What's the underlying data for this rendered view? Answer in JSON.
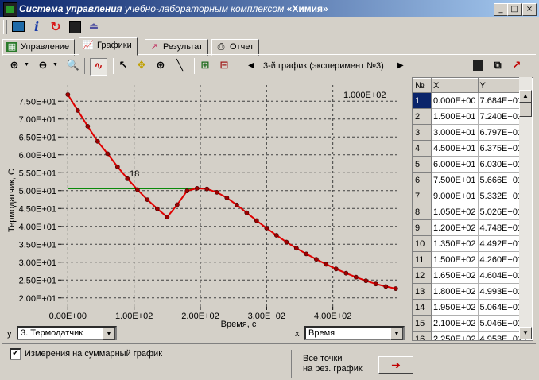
{
  "window": {
    "title_bold": "Система управления",
    "title_rest": " учебно-лабораторным комплексом ",
    "title_quoted": "«Химия»",
    "buttons": [
      "_",
      "□",
      "×"
    ]
  },
  "toolbar": {
    "icons": [
      "monitor-icon",
      "info-icon",
      "refresh-icon",
      "save-icon",
      "exit-icon"
    ],
    "info_glyph": "i"
  },
  "tabs": [
    {
      "label": "Управление"
    },
    {
      "label": "Графики"
    },
    {
      "label": "Результат"
    },
    {
      "label": "Отчет"
    }
  ],
  "graph_toolbar": {
    "nav_label": "3-й график (эксперимент №3)",
    "prev": "◀",
    "next": "▶"
  },
  "chart_data": {
    "type": "line",
    "xlabel": "Время, с",
    "ylabel": "Термодатчик, С",
    "corner_label": "1.000E+02",
    "point_marker": "18",
    "x_ticks": [
      "0.00E+00",
      "1.00E+02",
      "2.00E+02",
      "3.00E+02",
      "4.00E+02"
    ],
    "y_ticks": [
      "7.50E+01",
      "7.00E+01",
      "6.50E+01",
      "6.00E+01",
      "5.50E+01",
      "5.00E+01",
      "4.50E+01",
      "4.00E+01",
      "3.50E+01",
      "3.00E+01",
      "2.50E+01",
      "2.00E+01"
    ],
    "xlim": [
      -10,
      500
    ],
    "ylim": [
      17.5,
      79.5
    ],
    "hline": {
      "y": 50.6,
      "x_from": 0,
      "x_to": 210,
      "color": "#0a8a0a"
    },
    "series": [
      {
        "color": "#e00000",
        "x": [
          0,
          15,
          30,
          45,
          60,
          75,
          90,
          105,
          120,
          135,
          150,
          165,
          180,
          195,
          210,
          225,
          240,
          255,
          270,
          285,
          300,
          315,
          330,
          345,
          360,
          375,
          390,
          405,
          420,
          435,
          450,
          465,
          480,
          495
        ],
        "y": [
          76.84,
          72.4,
          67.97,
          63.75,
          60.3,
          56.66,
          53.32,
          50.26,
          47.48,
          44.92,
          42.6,
          46.04,
          49.93,
          50.64,
          50.46,
          49.53,
          48.0,
          46.0,
          43.8,
          41.6,
          39.5,
          37.5,
          35.6,
          33.9,
          32.3,
          30.8,
          29.4,
          28.1,
          26.9,
          25.8,
          24.8,
          23.9,
          23.2,
          22.6
        ]
      }
    ]
  },
  "table": {
    "headers": [
      "№",
      "X",
      "Y"
    ],
    "rows": [
      [
        "1",
        "0.000E+00",
        "7.684E+01"
      ],
      [
        "2",
        "1.500E+01",
        "7.240E+01"
      ],
      [
        "3",
        "3.000E+01",
        "6.797E+01"
      ],
      [
        "4",
        "4.500E+01",
        "6.375E+01"
      ],
      [
        "5",
        "6.000E+01",
        "6.030E+01"
      ],
      [
        "6",
        "7.500E+01",
        "5.666E+01"
      ],
      [
        "7",
        "9.000E+01",
        "5.332E+01"
      ],
      [
        "8",
        "1.050E+02",
        "5.026E+01"
      ],
      [
        "9",
        "1.200E+02",
        "4.748E+01"
      ],
      [
        "10",
        "1.350E+02",
        "4.492E+01"
      ],
      [
        "11",
        "1.500E+02",
        "4.260E+01"
      ],
      [
        "12",
        "1.650E+02",
        "4.604E+01"
      ],
      [
        "13",
        "1.800E+02",
        "4.993E+01"
      ],
      [
        "14",
        "1.950E+02",
        "5.064E+01"
      ],
      [
        "15",
        "2.100E+02",
        "5.046E+01"
      ],
      [
        "16",
        "2.250E+02",
        "4.953E+01"
      ]
    ]
  },
  "controls": {
    "y_axis_label": "y",
    "y_select": "3. Термодатчик",
    "x_axis_label": "x",
    "x_select": "Время"
  },
  "bottom": {
    "checkbox_label": "Измерения на суммарный график",
    "checkbox_checked": "✔",
    "all_points_line1": "Все точки",
    "all_points_line2": "на рез. график",
    "arrow": "➔"
  }
}
